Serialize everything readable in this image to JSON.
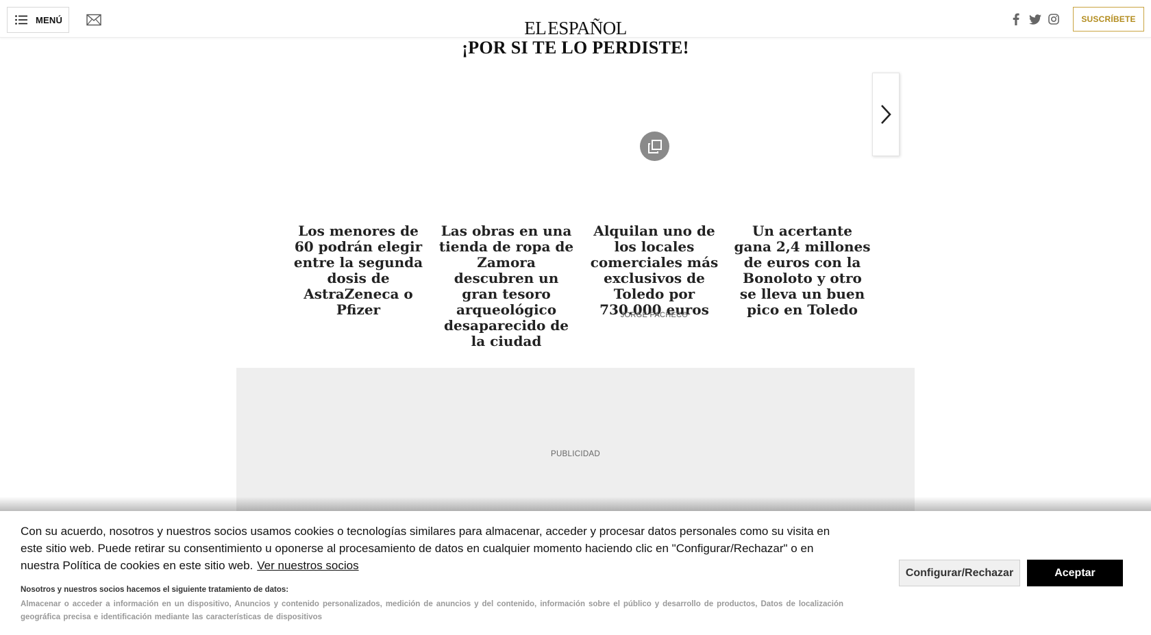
{
  "header": {
    "menu_label": "MENÚ",
    "logo_left": "EL",
    "logo_right": "ESPAÑOL",
    "subscribe_label": "SUSCRÍBETE",
    "icons": [
      "menu-icon",
      "mail-icon",
      "facebook-icon",
      "twitter-icon",
      "instagram-icon"
    ],
    "accent_color": "#b38c1e"
  },
  "section": {
    "title": "¡POR SI TE LO PERDISTE!",
    "cards": [
      {
        "title": "Los menores de 60 podrán elegir entre la segunda dosis de AstraZeneca o Pfizer"
      },
      {
        "title": "Las obras en una tienda de ropa de Zamora descubren un gran tesoro arqueológico desaparecido de la ciudad"
      },
      {
        "title": "Alquilan uno de los locales comerciales más exclusivos de Toledo por 730.000 euros",
        "author": "JORGE PACHECO",
        "icon": "gallery-icon"
      },
      {
        "title": "Un acertante gana 2,4 millones de euros con la Bonoloto y otro se lleva un buen pico en Toledo"
      }
    ],
    "next_icon": "chevron-right-icon"
  },
  "ad": {
    "label": "PUBLICIDAD"
  },
  "cookie": {
    "text": "Con su acuerdo, nosotros y nuestros socios usamos cookies o tecnologías similares para almacenar, acceder y procesar datos personales como su visita en este sitio web. Puede retirar su consentimiento u oponerse al procesamiento de datos en cualquier momento haciendo clic en \"Configurar/Rechazar\" o en nuestra Política de cookies en este sitio web.",
    "link_label": "Ver nuestros socios",
    "subheading": "Nosotros y nuestros socios hacemos el siguiente tratamiento de datos:",
    "purposes": "Almacenar o acceder a información en un dispositivo, Anuncios y contenido personalizados, medición de anuncios y del contenido, información sobre el público y desarrollo de productos, Datos de localización geográfica precisa e identificación mediante las características de dispositivos",
    "config_label": "Configurar/Rechazar",
    "accept_label": "Aceptar"
  }
}
